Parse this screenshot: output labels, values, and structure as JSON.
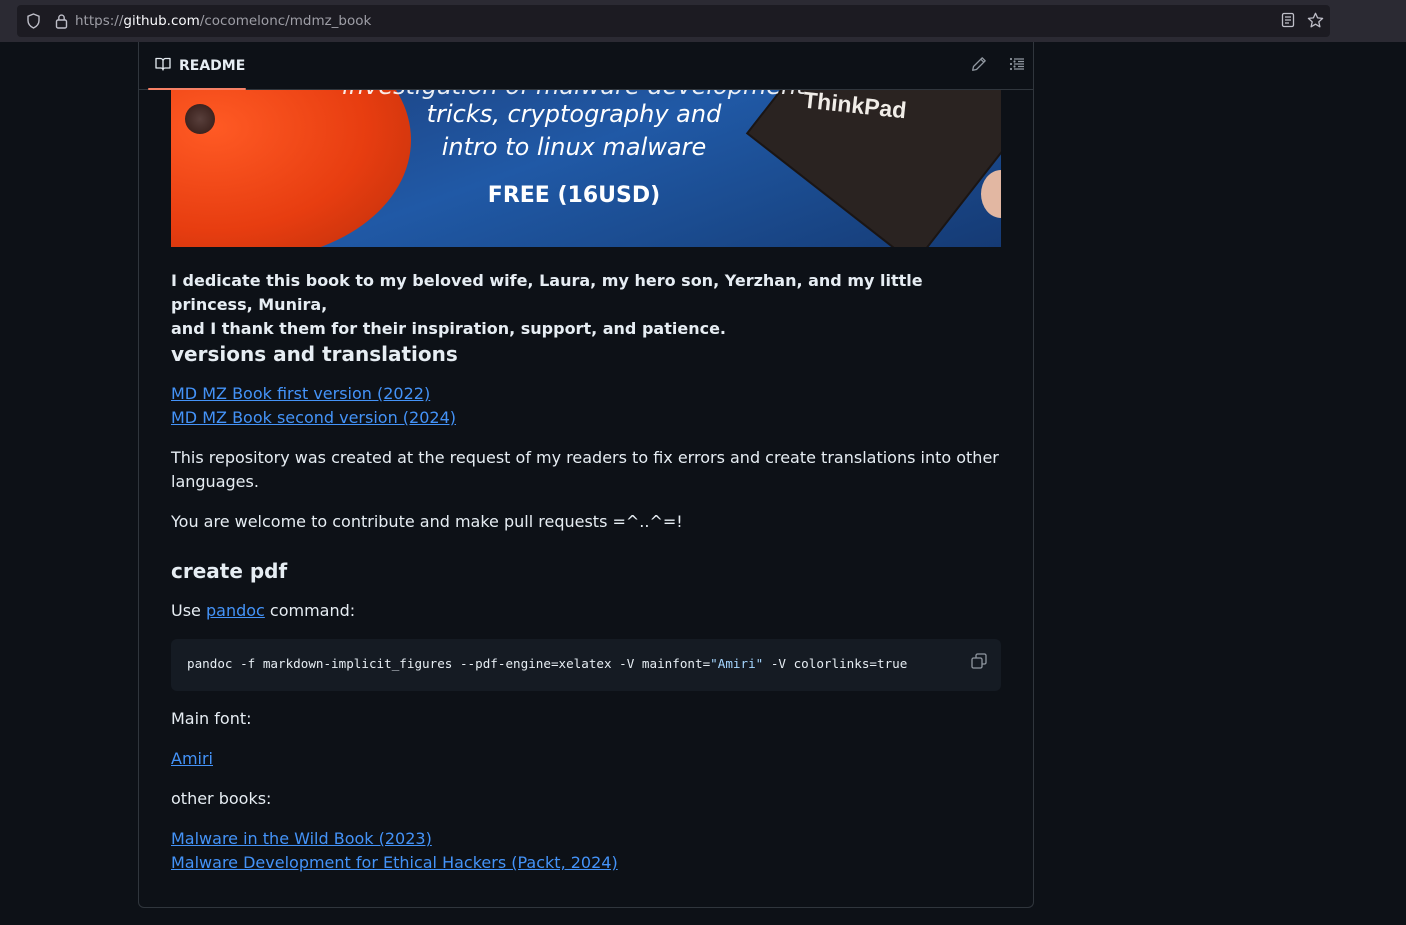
{
  "browser": {
    "url_scheme": "https://",
    "url_host": "github.com",
    "url_path": "/cocomelonc/mdmz_book"
  },
  "readme": {
    "tab_label": "README"
  },
  "banner": {
    "line0": "investigation of malware development",
    "line1": "tricks, cryptography and",
    "line2": "intro to linux malware",
    "price": "FREE (16USD)",
    "laptop_brand": "ThinkPad"
  },
  "content": {
    "dedication_1": "I dedicate this book to my beloved wife, Laura, my hero son, Yerzhan, and my little princess, Munira,",
    "dedication_2": "and I thank them for their inspiration, support, and patience.",
    "h_versions": "versions and translations",
    "link_v1": "MD MZ Book first version (2022)",
    "link_v2": "MD MZ Book second version (2024)",
    "repo_note_1": "This repository was created at the request of my readers to fix errors and create translations into other",
    "repo_note_2": "languages.",
    "welcome": "You are welcome to contribute and make pull requests =^..^=!",
    "h_pdf": "create pdf",
    "use_prefix": "Use ",
    "use_link": "pandoc",
    "use_suffix": " command:",
    "code_part1": "pandoc -f markdown-implicit_figures --pdf-engine=xelatex -V mainfont=",
    "code_str": "\"Amiri\"",
    "code_part2": " -V colorlinks=true",
    "main_font_label": "Main font:",
    "font_link": "Amiri",
    "other_books_label": "other books:",
    "book_link_1": "Malware in the Wild Book (2023)",
    "book_link_2": "Malware Development for Ethical Hackers (Packt, 2024)"
  },
  "icons": [
    "shield-icon",
    "lock-icon",
    "reader-view-icon",
    "bookmark-star-icon",
    "book-icon",
    "pencil-icon",
    "outline-list-icon",
    "copy-icon"
  ],
  "colors": {
    "link": "#4493f8",
    "accent_underline": "#f78166",
    "background": "#0d1117",
    "code_bg": "#151b23"
  }
}
